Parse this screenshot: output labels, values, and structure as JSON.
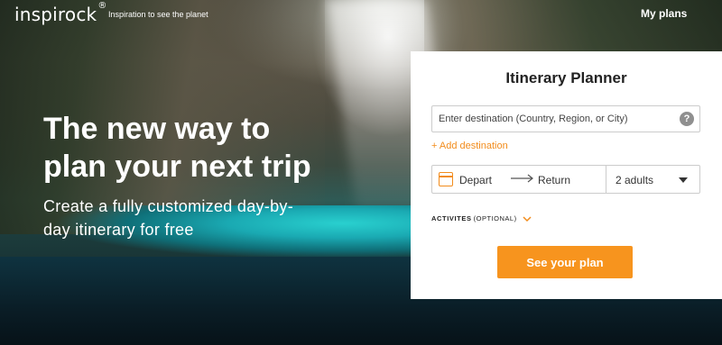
{
  "header": {
    "logo_text": "inspirock",
    "logo_mark": "®",
    "tagline": "Inspiration to see the planet",
    "my_plans": "My plans"
  },
  "hero": {
    "title": "The new way to plan your next trip",
    "subtitle": "Create a fully customized day-by-day itinerary for free"
  },
  "planner": {
    "title": "Itinerary Planner",
    "destination_placeholder": "Enter destination (Country, Region, or City)",
    "help_icon": "?",
    "add_destination": "+ Add destination",
    "depart": "Depart",
    "return": "Return",
    "travelers": "2 adults",
    "activities_label": "ACTIVITES",
    "activities_optional": "(OPTIONAL)",
    "cta": "See your plan"
  },
  "colors": {
    "accent": "#f7941e",
    "accent_text": "#f28c1c",
    "panel_bg": "#ffffff"
  },
  "icons": [
    "calendar-icon",
    "arrow-right-icon",
    "caret-down-icon",
    "chevron-down-icon",
    "help-icon"
  ]
}
